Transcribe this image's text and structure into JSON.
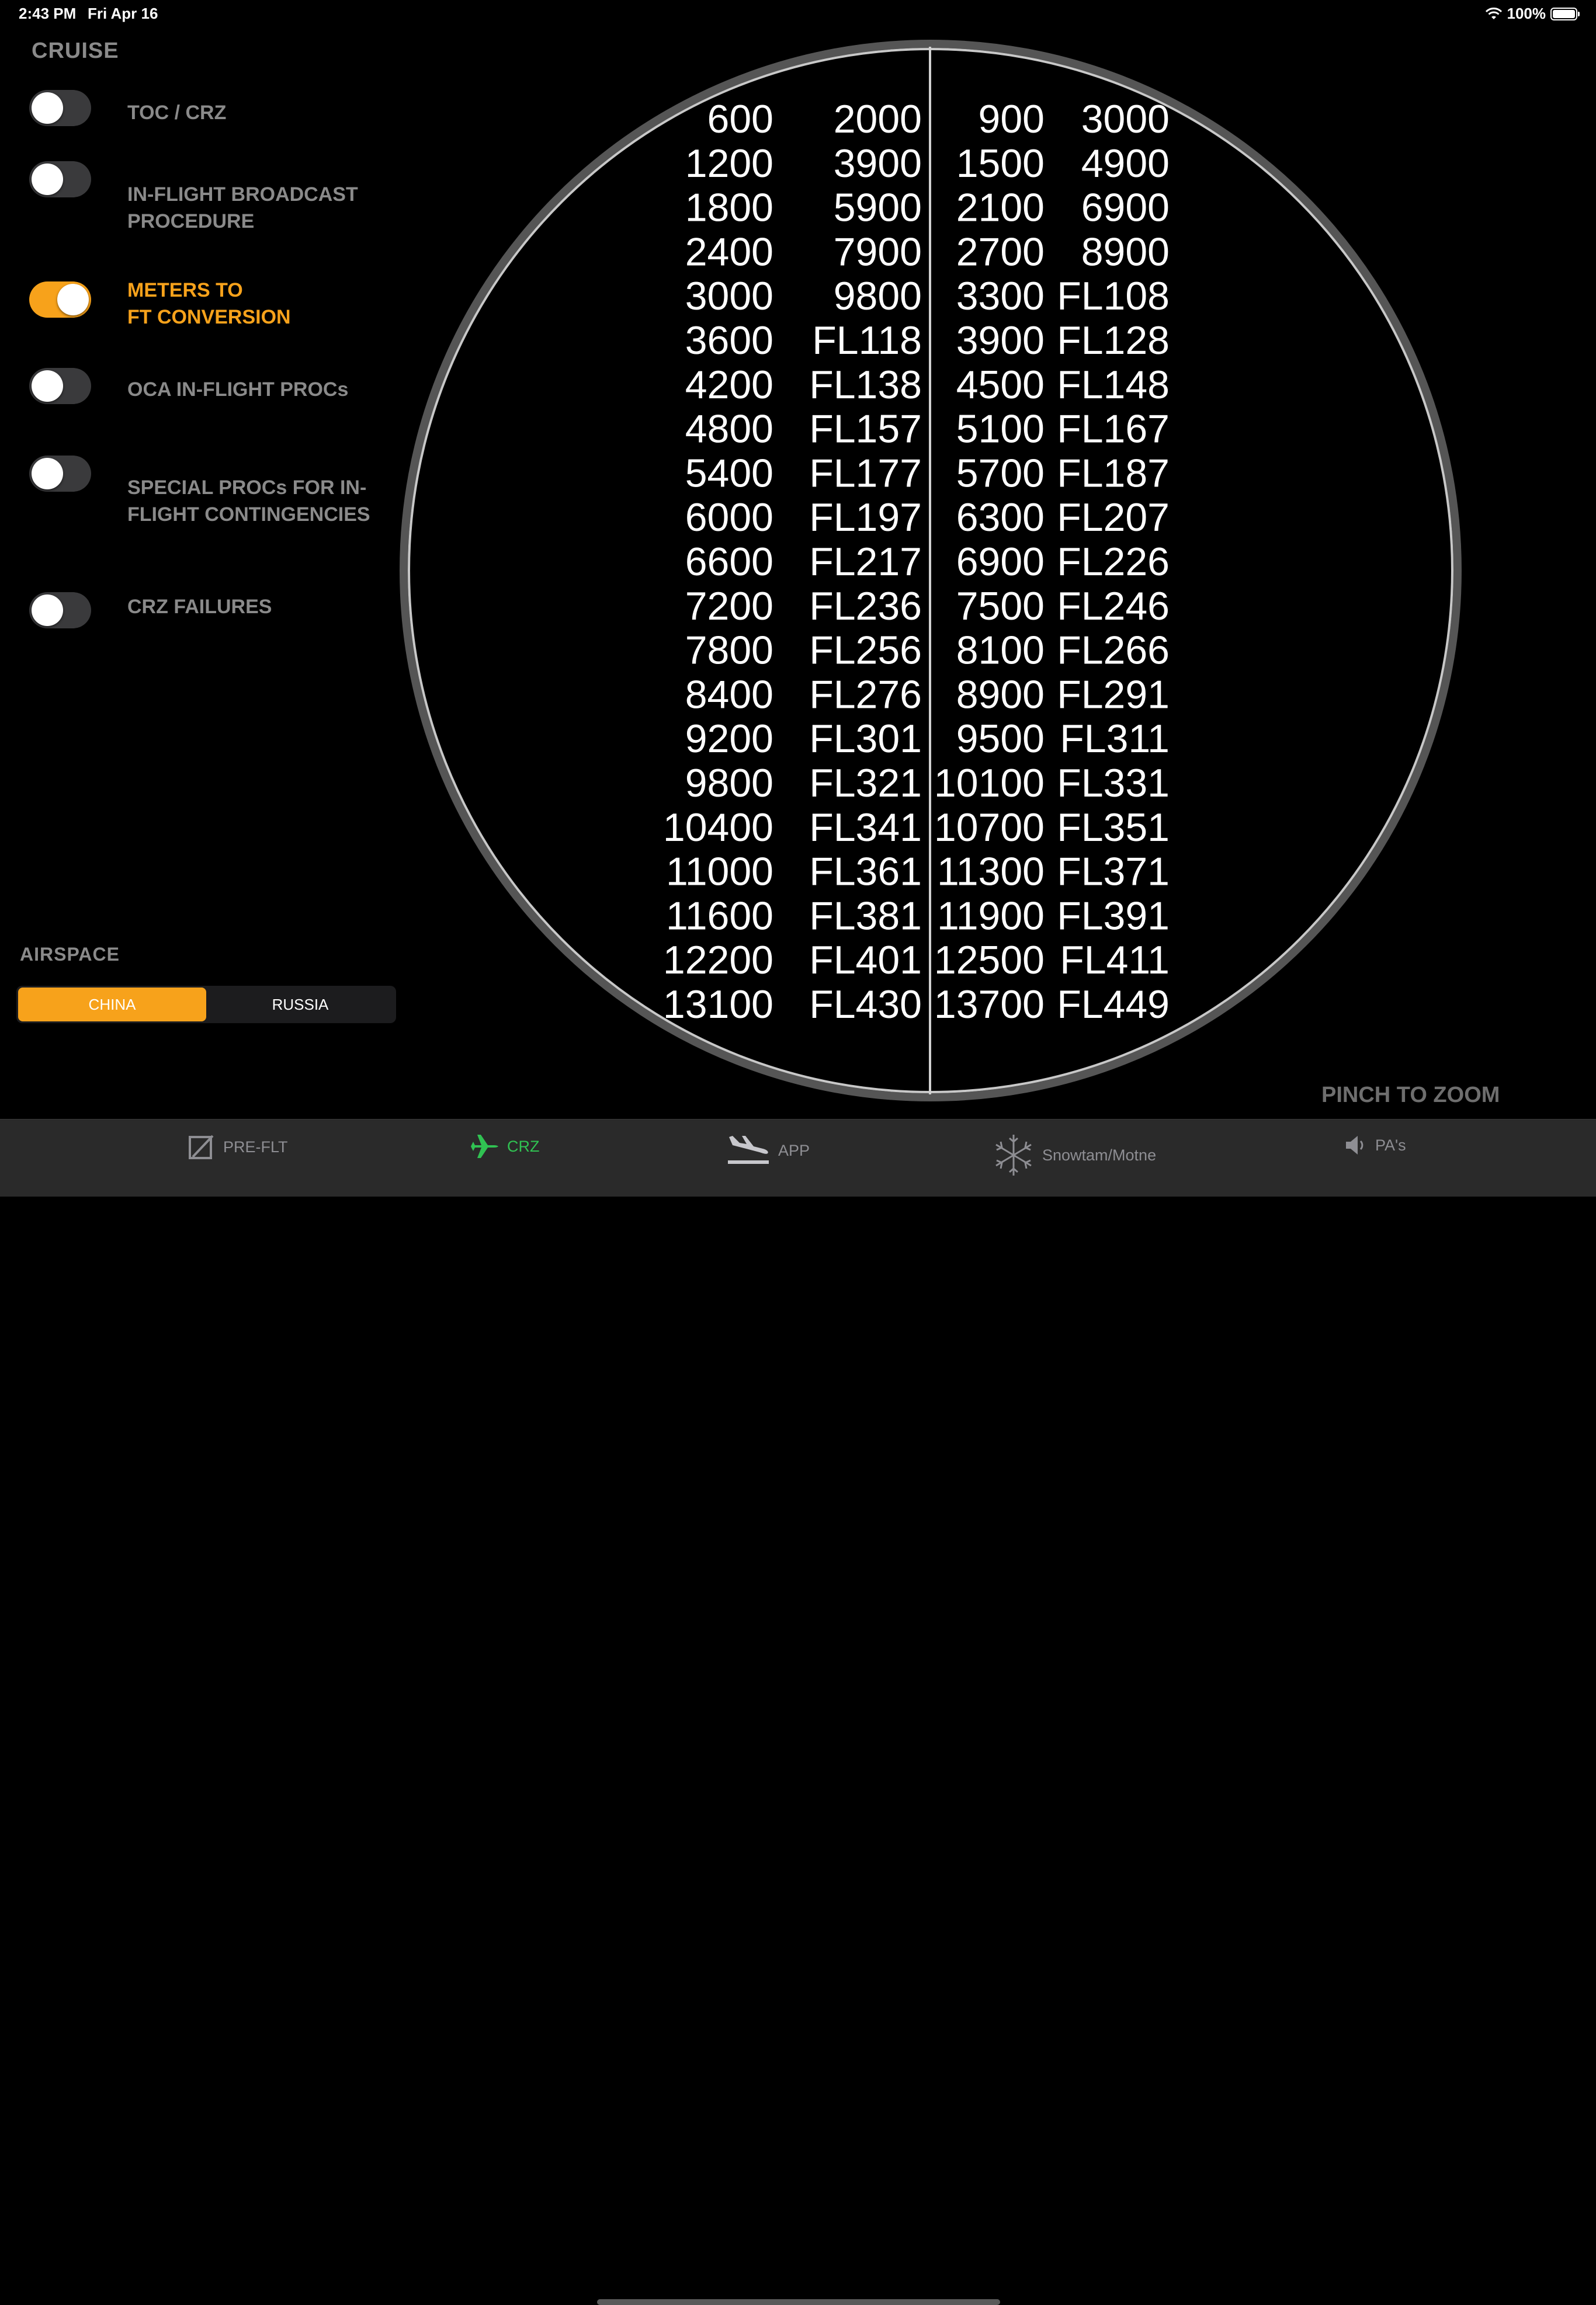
{
  "status_bar": {
    "time": "2:43 PM",
    "date": "Fri Apr 16",
    "battery": "100%"
  },
  "sidebar": {
    "title": "CRUISE",
    "items": [
      {
        "label": "TOC / CRZ",
        "on": false
      },
      {
        "label": "IN-FLIGHT BROADCAST\nPROCEDURE",
        "on": false
      },
      {
        "label": "METERS TO\nFT CONVERSION",
        "on": true
      },
      {
        "label": "OCA IN-FLIGHT  PROCs",
        "on": false
      },
      {
        "label": "SPECIAL PROCs FOR IN-\nFLIGHT CONTINGENCIES",
        "on": false
      },
      {
        "label": "CRZ FAILURES",
        "on": false
      }
    ],
    "airspace": {
      "title": "AIRSPACE",
      "options": [
        "CHINA",
        "RUSSIA"
      ],
      "selected": "CHINA"
    }
  },
  "conversion_table": {
    "rows": [
      [
        "600",
        "2000",
        "900",
        "3000"
      ],
      [
        "1200",
        "3900",
        "1500",
        "4900"
      ],
      [
        "1800",
        "5900",
        "2100",
        "6900"
      ],
      [
        "2400",
        "7900",
        "2700",
        "8900"
      ],
      [
        "3000",
        "9800",
        "3300",
        "FL108"
      ],
      [
        "3600",
        "FL118",
        "3900",
        "FL128"
      ],
      [
        "4200",
        "FL138",
        "4500",
        "FL148"
      ],
      [
        "4800",
        "FL157",
        "5100",
        "FL167"
      ],
      [
        "5400",
        "FL177",
        "5700",
        "FL187"
      ],
      [
        "6000",
        "FL197",
        "6300",
        "FL207"
      ],
      [
        "6600",
        "FL217",
        "6900",
        "FL226"
      ],
      [
        "7200",
        "FL236",
        "7500",
        "FL246"
      ],
      [
        "7800",
        "FL256",
        "8100",
        "FL266"
      ],
      [
        "8400",
        "FL276",
        "8900",
        "FL291"
      ],
      [
        "9200",
        "FL301",
        "9500",
        "FL311"
      ],
      [
        "9800",
        "FL321",
        "10100",
        "FL331"
      ],
      [
        "10400",
        "FL341",
        "10700",
        "FL351"
      ],
      [
        "11000",
        "FL361",
        "11300",
        "FL371"
      ],
      [
        "11600",
        "FL381",
        "11900",
        "FL391"
      ],
      [
        "12200",
        "FL401",
        "12500",
        "FL411"
      ],
      [
        "13100",
        "FL430",
        "13700",
        "FL449"
      ]
    ]
  },
  "hint": "PINCH TO ZOOM",
  "tab_bar": {
    "tabs": [
      {
        "label": "PRE-FLT",
        "icon": "checkbox-icon",
        "active": false
      },
      {
        "label": "CRZ",
        "icon": "airplane-icon",
        "active": true
      },
      {
        "label": "APP",
        "icon": "landing-icon",
        "active": false
      },
      {
        "label": "Snowtam/Motne",
        "icon": "snowflake-icon",
        "active": false
      },
      {
        "label": "PA's",
        "icon": "speaker-icon",
        "active": false
      }
    ]
  },
  "colors": {
    "accent": "#f7a21b",
    "active_tab": "#30c252",
    "muted": "#8a8a8a"
  }
}
